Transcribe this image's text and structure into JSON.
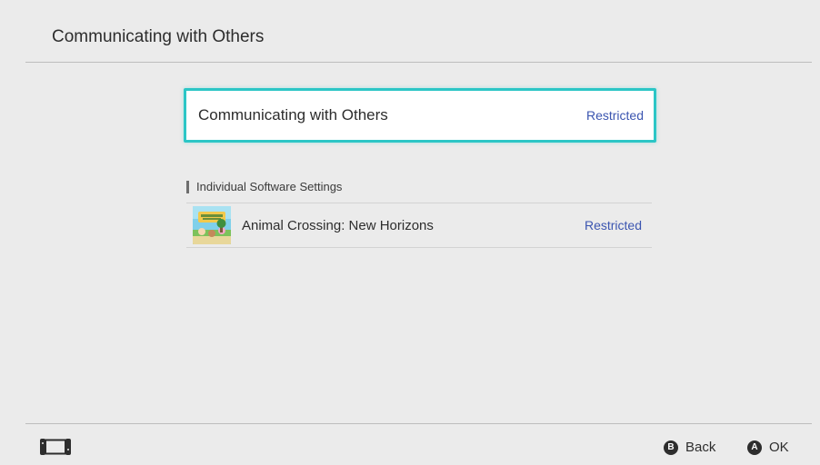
{
  "header": {
    "title": "Communicating with Others"
  },
  "main_setting": {
    "label": "Communicating with Others",
    "value": "Restricted"
  },
  "section": {
    "heading": "Individual Software Settings"
  },
  "software": [
    {
      "name": "Animal Crossing: New Horizons",
      "value": "Restricted",
      "icon": "animal-crossing-thumbnail"
    }
  ],
  "footer": {
    "device_icon": "switch-console-icon",
    "back": {
      "key": "B",
      "label": "Back"
    },
    "ok": {
      "key": "A",
      "label": "OK"
    }
  },
  "colors": {
    "background": "#ebebeb",
    "focus_border": "#2cc6c6",
    "value_text": "#3b55b0",
    "divider": "#bdbdbd"
  }
}
